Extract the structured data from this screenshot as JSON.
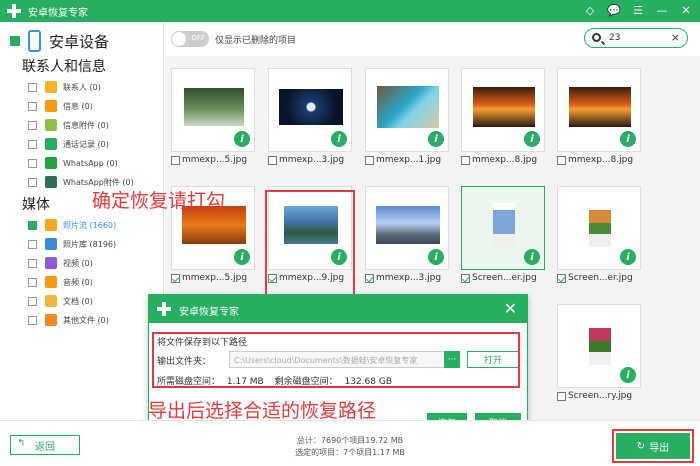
{
  "window": {
    "title": "安卓恢复专家",
    "icons": [
      "vip-diamond-icon",
      "chat-icon",
      "menu-icon",
      "minimize-icon",
      "close-icon"
    ]
  },
  "sidebar": {
    "device_label": "安卓设备",
    "section_contacts": "联系人和信息",
    "contacts_items": [
      {
        "label": "联系人 (0)",
        "icon": "contacts-icon",
        "color": "#f0b429"
      },
      {
        "label": "信息 (0)",
        "icon": "message-icon",
        "color": "#f39c12"
      },
      {
        "label": "信息附件 (0)",
        "icon": "attachment-icon",
        "color": "#8bc34a"
      },
      {
        "label": "通话记录 (0)",
        "icon": "call-log-icon",
        "color": "#27ae60"
      },
      {
        "label": "WhatsApp (0)",
        "icon": "whatsapp-icon",
        "color": "#25a244"
      },
      {
        "label": "WhatsApp附件 (0)",
        "icon": "whatsapp-attachment-icon",
        "color": "#2f6f4f"
      }
    ],
    "section_media": "媒体",
    "media_items": [
      {
        "label": "照片流 (1660)",
        "icon": "photo-stream-icon",
        "color": "#f5a623",
        "checked": true,
        "active": true
      },
      {
        "label": "照片库 (8196)",
        "icon": "photo-library-icon",
        "color": "#3b8bd8",
        "checked": false
      },
      {
        "label": "视频 (0)",
        "icon": "video-icon",
        "color": "#8e5bd8",
        "checked": false
      },
      {
        "label": "音频 (0)",
        "icon": "audio-icon",
        "color": "#f39c12",
        "checked": false
      },
      {
        "label": "文档 (0)",
        "icon": "document-icon",
        "color": "#f5b342",
        "checked": false
      },
      {
        "label": "其他文件 (0)",
        "icon": "other-files-icon",
        "color": "#f08a24",
        "checked": false
      }
    ]
  },
  "toolbar": {
    "toggle_state": "OFF",
    "toggle_label": "仅显示已删除的项目",
    "search_value": "23"
  },
  "files": [
    {
      "name": "mmexp...5.jpg",
      "checked": false,
      "pic": "forest-waterfall"
    },
    {
      "name": "mmexp...3.jpg",
      "checked": false,
      "pic": "night-moon"
    },
    {
      "name": "mmexp...1.jpg",
      "checked": false,
      "pic": "beach-cliff"
    },
    {
      "name": "mmexp...8.jpg",
      "checked": false,
      "pic": "sunset-sea"
    },
    {
      "name": "mmexp...8.jpg",
      "checked": false,
      "pic": "sunset-sea-2"
    },
    {
      "name": "mmexp...5.jpg",
      "checked": true,
      "pic": "autumn-tree"
    },
    {
      "name": "mmexp...9.jpg",
      "checked": true,
      "pic": "lake-mountain"
    },
    {
      "name": "mmexp...3.jpg",
      "checked": true,
      "pic": "mountain-sky"
    },
    {
      "name": "Screen...er.jpg",
      "checked": true,
      "pic": "phone-screenshot",
      "selected": true
    },
    {
      "name": "Screen...er.jpg",
      "checked": true,
      "pic": "phone-screenshot-2"
    },
    {
      "name": "Screen...ry.jpg",
      "checked": false,
      "pic": "phone-screenshot-3"
    }
  ],
  "annotations": {
    "check_hint": "确定恢复请打勾",
    "export_hint": "导出后选择合适的恢复路径"
  },
  "dialog": {
    "title": "安卓恢复专家",
    "save_prompt": "将文件保存到以下路径",
    "output_folder_label": "输出文件夹：",
    "output_path": "C:\\Users\\cloud\\Documents\\数据蛙\\安卓恢复专家",
    "browse_label": "···",
    "open_label": "打开",
    "required_space_label": "所需磁盘空间：",
    "required_space_value": "1.17 MB",
    "remaining_space_label": "剩余磁盘空间：",
    "remaining_space_value": "132.68 GB",
    "recover_label": "恢复",
    "cancel_label": "取消"
  },
  "footer": {
    "back_label": "返回",
    "total_line": "总计：7690个项目19.72 MB",
    "selected_line": "选定的项目：7个项目1.17 MB",
    "export_label": "导出"
  },
  "colors": {
    "brand_green": "#27ae60",
    "annotation_red": "#e03c3c",
    "link_blue": "#3a8ee6"
  }
}
